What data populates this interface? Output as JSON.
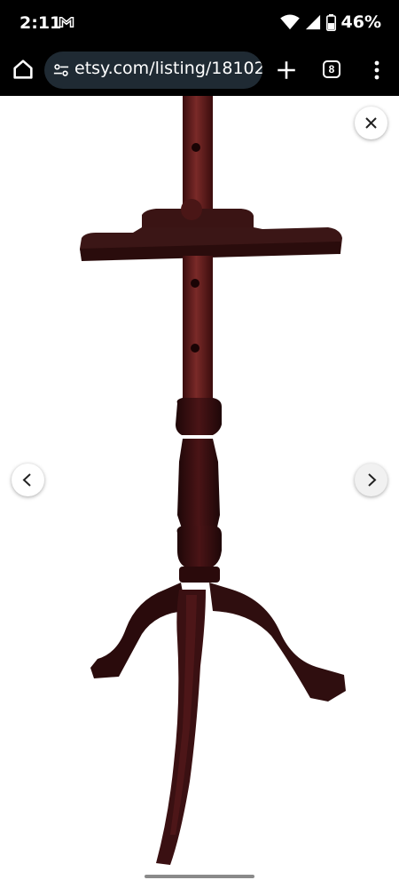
{
  "status_bar": {
    "time": "2:11",
    "battery": "46%",
    "icons": [
      "gmail-icon",
      "wifi-icon",
      "signal-icon",
      "battery-icon"
    ]
  },
  "browser": {
    "url": "etsy.com/listing/18102",
    "tab_count": "8",
    "icons": [
      "home-icon",
      "tune-icon",
      "plus-icon",
      "more-vert-icon"
    ]
  },
  "viewer": {
    "controls": [
      "close-icon",
      "chevron-left-icon",
      "chevron-right-icon"
    ]
  },
  "colors": {
    "wood_dark": "#3a0e10",
    "wood_mid": "#5a1a1c",
    "wood_light": "#7a2a2a",
    "chrome_bg": "#000000",
    "omnibox_bg": "#1f2a33"
  }
}
